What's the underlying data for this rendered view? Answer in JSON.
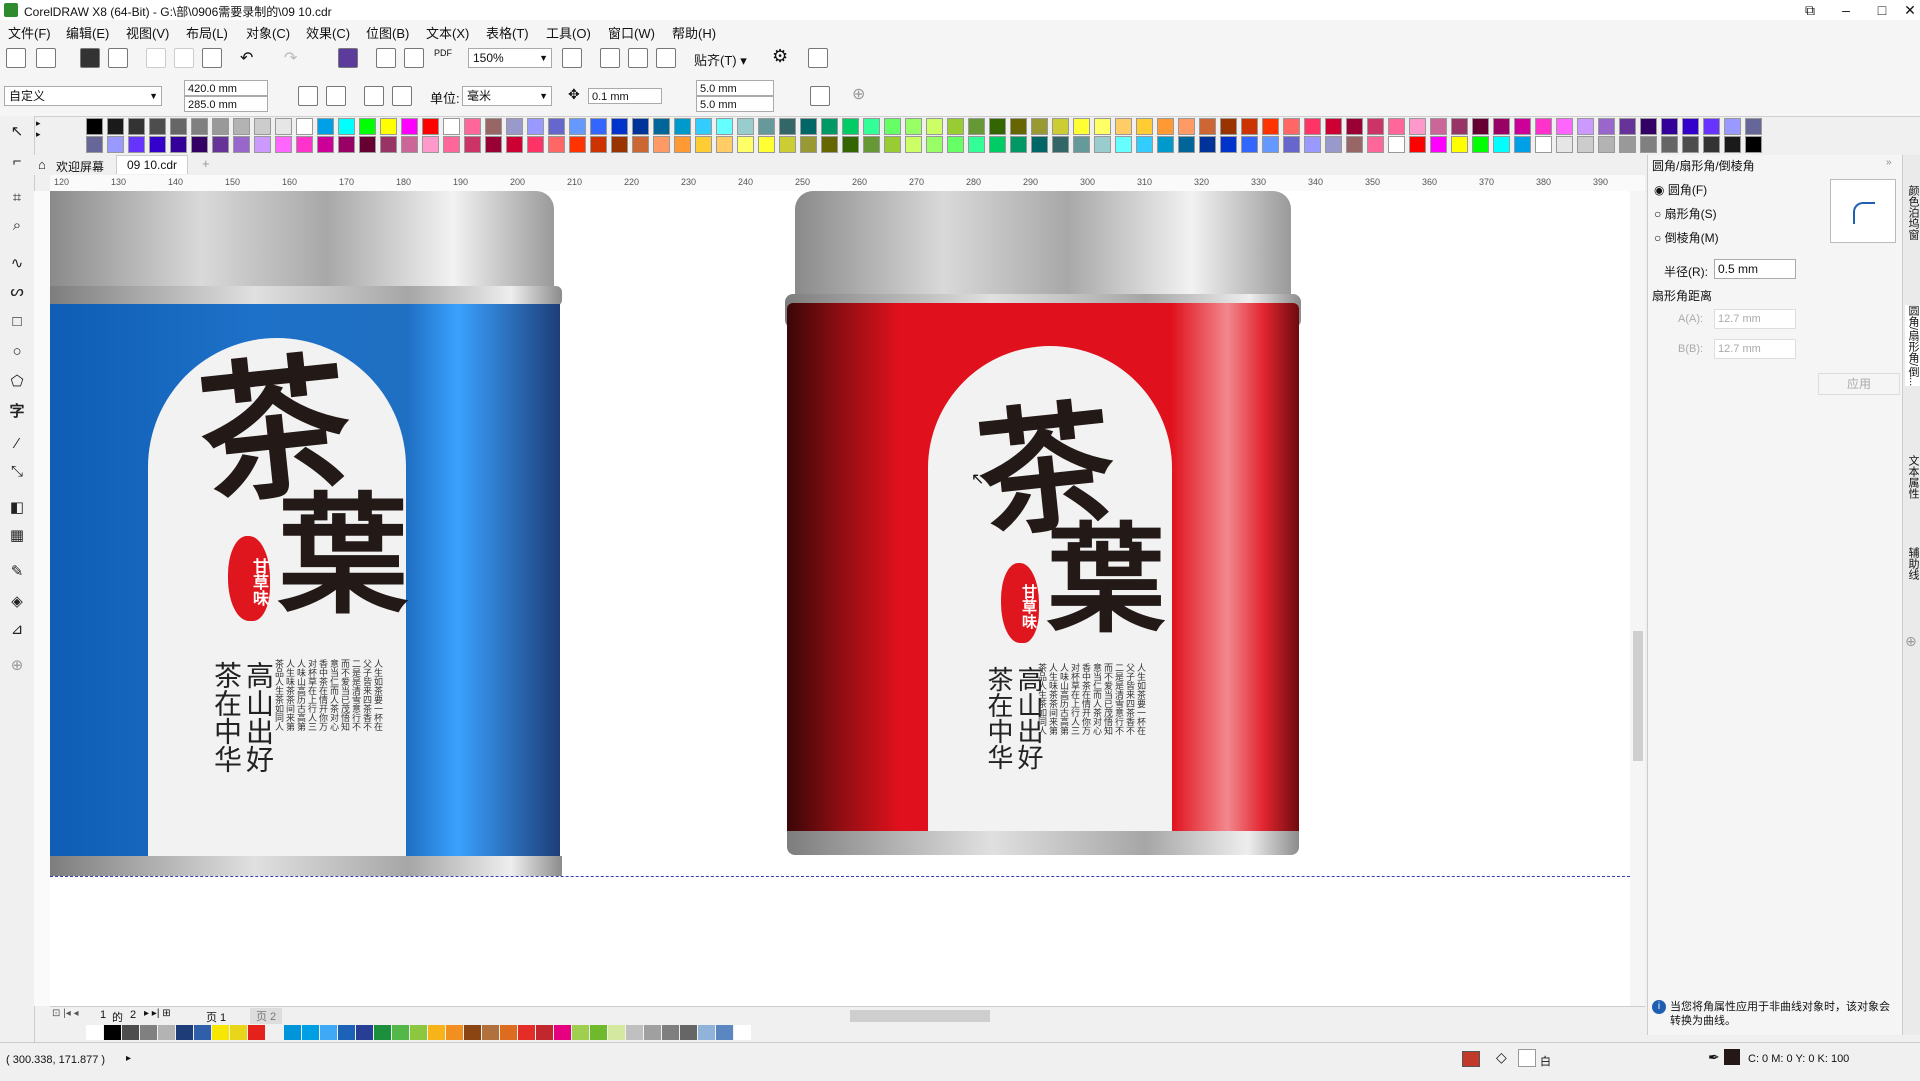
{
  "window": {
    "title": "CorelDRAW X8 (64-Bit) - G:\\部\\0906需要录制的\\09 10.cdr"
  },
  "menu": [
    "文件(F)",
    "编辑(E)",
    "视图(V)",
    "布局(L)",
    "对象(C)",
    "效果(C)",
    "位图(B)",
    "文本(X)",
    "表格(T)",
    "工具(O)",
    "窗口(W)",
    "帮助(H)"
  ],
  "toolbar": {
    "zoom": "150%",
    "snap_label": "贴齐(T)",
    "pdf_label": "PDF"
  },
  "propbar": {
    "preset": "自定义",
    "width": "420.0 mm",
    "height": "285.0 mm",
    "unit_label": "单位:",
    "unit": "毫米",
    "nudge": "0.1 mm",
    "dup_x": "5.0 mm",
    "dup_y": "5.0 mm"
  },
  "tabs": {
    "welcome": "欢迎屏幕",
    "doc": "09 10.cdr"
  },
  "ruler": {
    "ticks": [
      "120",
      "130",
      "140",
      "150",
      "160",
      "170",
      "180",
      "190",
      "200",
      "210",
      "220",
      "230",
      "240",
      "250",
      "260",
      "270",
      "280",
      "290",
      "300",
      "310",
      "320",
      "330",
      "340",
      "350",
      "360",
      "370",
      "380",
      "390"
    ]
  },
  "design": {
    "title_chars": [
      "茶",
      "葉"
    ],
    "seal_text": "甘草味",
    "slogan_cols": [
      "高山出好",
      "茶在中华"
    ],
    "poem_cols": [
      "人生如茶要一杯在",
      "父子皆来四茶香不",
      "二是是清雪意行不",
      "而不爱当已茂悟知",
      "意当仁而人茶对心",
      "香中茶在情开你万",
      "对杯草在上行人三",
      "人味山高历古高第",
      "人生味茶茶间来第",
      "茶品人生茶如同人"
    ],
    "blue_color": "#1e6fc4",
    "red_color": "#e0111d"
  },
  "panel": {
    "title": "圆角/扇形角/倒棱角",
    "opt_round": "圆角(F)",
    "opt_scallop": "扇形角(S)",
    "opt_chamfer": "倒棱角(M)",
    "radius_label": "半径(R):",
    "radius_value": "0.5 mm",
    "distance_label": "扇形角距离",
    "a_label": "A(A):",
    "a_value": "12.7 mm",
    "b_label": "B(B):",
    "b_value": "12.7 mm",
    "apply": "应用",
    "info": "当您将角属性应用于非曲线对象时，该对象会转换为曲线。",
    "side_tabs": [
      "颜色泊坞窗",
      "圆角/扇形角/倒...",
      "文本属性",
      "辅助线"
    ]
  },
  "pagebar": {
    "page_index": "1",
    "of_label": "的",
    "page_total": "2",
    "page1": "页 1",
    "page2": "页 2"
  },
  "status": {
    "coords": "( 300.338, 171.877 )",
    "fill_label": "白",
    "outline": "C: 0 M: 0 Y: 0 K: 100"
  },
  "palette_colors": [
    "#000000",
    "#1a1a1a",
    "#333333",
    "#4d4d4d",
    "#666666",
    "#808080",
    "#999999",
    "#b3b3b3",
    "#cccccc",
    "#e6e6e6",
    "#ffffff",
    "#00a0e9",
    "#00ffff",
    "#00ff00",
    "#ffff00",
    "#ff00ff",
    "#ff0000",
    "#ffffff",
    "#ff6699",
    "#996666",
    "#9999cc",
    "#9999ff",
    "#6666cc",
    "#6699ff",
    "#3366ff",
    "#0033cc",
    "#003399",
    "#006699",
    "#0099cc",
    "#33ccff",
    "#66ffff",
    "#99cccc",
    "#669999",
    "#336666",
    "#006666",
    "#009966",
    "#00cc66",
    "#33ff99",
    "#66ff66",
    "#99ff66",
    "#ccff66",
    "#99cc33",
    "#669933",
    "#336600",
    "#666600",
    "#999933",
    "#cccc33",
    "#ffff33",
    "#ffff66",
    "#ffcc66",
    "#ffcc33",
    "#ff9933",
    "#ff9966",
    "#cc6633",
    "#993300",
    "#cc3300",
    "#ff3300",
    "#ff6666",
    "#ff3366",
    "#cc0033",
    "#990033",
    "#cc3366",
    "#ff6699",
    "#ff99cc",
    "#cc6699",
    "#993366",
    "#660033",
    "#990066",
    "#cc0099",
    "#ff33cc",
    "#ff66ff",
    "#cc99ff",
    "#9966cc",
    "#663399",
    "#330066",
    "#330099",
    "#3300cc",
    "#6633ff",
    "#9999ff",
    "#666699"
  ],
  "bottom_palette": [
    "#ffffff",
    "#000000",
    "#4d4d4d",
    "#808080",
    "#b3b3b3",
    "#1e3c78",
    "#2e5fa8",
    "#f6e600",
    "#e9d51a",
    "#e4211b",
    "#f0f0f0",
    "#0095da",
    "#009fe3",
    "#3fa9f5",
    "#1c63b7",
    "#263f95",
    "#1b8f3b",
    "#53b848",
    "#8dc63f",
    "#f8b319",
    "#f19020",
    "#8b4513",
    "#b0713c",
    "#dd6c1f",
    "#e52d27",
    "#c1272d",
    "#e4007f",
    "#a0ce4e",
    "#6fba2c",
    "#d4e8a0",
    "#c0c0c0",
    "#a0a0a0",
    "#7f7f7f",
    "#666666",
    "#8fb3d9",
    "#5a86c2",
    "#ffffff"
  ]
}
